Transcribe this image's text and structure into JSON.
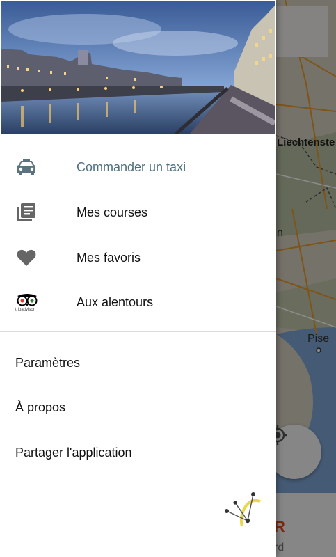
{
  "map": {
    "labels": {
      "liechtenstein": "Liechtenste",
      "partial_n": "n",
      "pise": "Pise"
    },
    "bottom_card": {
      "red_text": "R",
      "grey_text": "rd"
    },
    "locate_icon": "my-location-icon"
  },
  "drawer": {
    "header_image": "city-riverfront-at-dusk",
    "menu": [
      {
        "label": "Commander un taxi",
        "icon": "taxi-icon",
        "active": true
      },
      {
        "label": "Mes courses",
        "icon": "list-icon",
        "active": false
      },
      {
        "label": "Mes favoris",
        "icon": "heart-icon",
        "active": false
      },
      {
        "label": "Aux alentours",
        "icon": "tripadvisor-icon",
        "active": false
      }
    ],
    "secondary": [
      {
        "label": "Paramètres"
      },
      {
        "label": "À propos"
      },
      {
        "label": "Partager l'application"
      }
    ],
    "tripadvisor_wordmark": "tripadvisor",
    "brand_logo": "app-logo-icon"
  },
  "colors": {
    "active_text": "#4e6f7f",
    "icon_grey": "#616161",
    "map_water": "#7fa7d6",
    "map_border": "#e59a2a"
  }
}
